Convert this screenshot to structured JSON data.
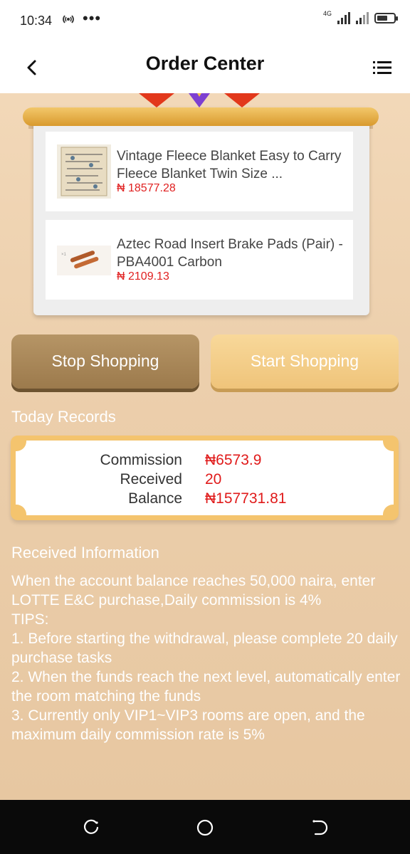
{
  "status_bar": {
    "time": "10:34",
    "network_label": "4G",
    "icons": [
      "hotspot-icon",
      "more-dots-icon",
      "signal-icon",
      "battery-icon"
    ]
  },
  "header": {
    "title": "Order Center",
    "back_icon": "chevron-left-icon",
    "menu_icon": "list-menu-icon"
  },
  "products": [
    {
      "name": "Vintage Fleece Blanket Easy to Carry Fleece Blanket Twin Size ...",
      "price": "₦ 18577.28"
    },
    {
      "name": "Aztec Road Insert Brake Pads (Pair) - PBA4001 Carbon",
      "price": "₦ 2109.13"
    }
  ],
  "actions": {
    "stop_label": "Stop Shopping",
    "start_label": "Start Shopping"
  },
  "today_records": {
    "title": "Today Records",
    "rows": [
      {
        "label": "Commission",
        "value": "₦6573.9"
      },
      {
        "label": "Received",
        "value": "20"
      },
      {
        "label": "Balance",
        "value": "₦157731.81"
      }
    ]
  },
  "received_information": {
    "title": "Received Information",
    "lines": [
      "When the account balance reaches 50,000 naira, enter LOTTE E&C purchase,Daily commission is 4%",
      "TIPS:",
      "1. Before starting the withdrawal, please complete 20 daily purchase tasks",
      "2. When the funds reach the next level, automatically enter the room matching the funds",
      "3. Currently only VIP1~VIP3 rooms are open, and the maximum daily commission rate is 5%"
    ]
  },
  "colors": {
    "accent_gold": "#f4c46e",
    "price_red": "#e02020",
    "stop_button": "#a88658",
    "start_button": "#f4cf8a"
  },
  "nav_bar": {
    "icons": [
      "recent-apps-icon",
      "home-icon",
      "back-icon"
    ]
  }
}
